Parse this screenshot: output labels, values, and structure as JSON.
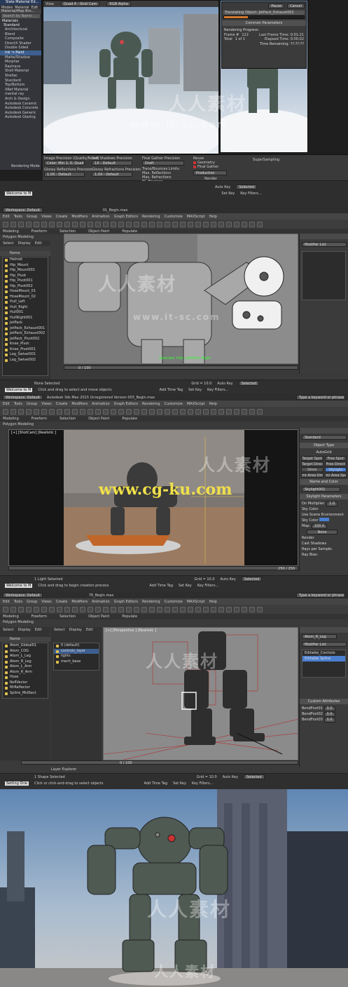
{
  "screen1": {
    "mat_browser_title": "Slate Material Ed...",
    "mat_browser_menu": [
      "Modes",
      "Material",
      "Edit"
    ],
    "mat_browser_search": "Search by Name ...",
    "mat_sections": [
      "Material/Map Bro...",
      "Materials",
      "Standard"
    ],
    "materials": [
      "Architectural",
      "Blend",
      "Composite",
      "DirectX Shader",
      "Double Sided",
      "Ink 'n Paint",
      "Matte/Shadow",
      "Morpher",
      "Raytrace",
      "Shell Material",
      "Shellac",
      "Standard",
      "Top/Bottom",
      "XRef Material",
      "mental ray",
      "Arch & Design",
      "Autodesk Ceramic",
      "Autodesk Concrete",
      "Autodesk Generic",
      "Autodesk Glazing"
    ],
    "render_setup_label": "Rendering Mode",
    "frame_toolbar": {
      "area": "View",
      "viewport": "Quad 4 - Shot Cam",
      "channel": "RGB Alpha"
    },
    "rendering_dialog": {
      "pause": "Pause",
      "cancel": "Cancel",
      "translating": "Translating Object: JetPack_Exhaust002",
      "common_params": "Common Parameters",
      "rendering_progress": "Rendering Progress:",
      "frame_label": "Frame #",
      "frame_value": "122",
      "total_label": "Total",
      "total_value": "1 of 1",
      "last_frame_time": "Last Frame Time:  0:01:21",
      "elapsed_time": "Elapsed Time:  0:00:02",
      "time_remaining": "Time Remaining:  ??:??:??"
    },
    "precision": {
      "image": "Image Precision (Quality/Noise)",
      "image_value": "Color: Min 1, 0, Quality 0.25",
      "soft_shadows": "Soft Shadows Precision",
      "soft_value": "1X - Default",
      "final_gather": "Final Gather Precision",
      "fg_value": "Draft",
      "glossy_refl": "Glossy Reflections Precision",
      "glossy_refl_value": "1.0X - Default",
      "glossy_refr": "Glossy Refractions Precision",
      "glossy_refr_value": "1.0X - Default",
      "trace_depth": "Trace/Bounces Limits",
      "max_refl": "Max. Reflections",
      "max_refr": "Max. Refractions",
      "fg_bounces": "FG Bounces",
      "reuse": "Reuse",
      "geometry": "Geometry",
      "final_gather_chk": "Final Gather",
      "production": "Production",
      "render_btn": "Render",
      "supersampling": "SuperSampling"
    },
    "status": {
      "welcome": "Welcome to M",
      "selected": "Selected",
      "auto_key": "Auto Key",
      "set_key": "Set Key",
      "key_filters": "Key Filters..."
    }
  },
  "screen2": {
    "file_title": "01_Begin.max",
    "workspace": "Workspace: Default",
    "menus": [
      "Edit",
      "Tools",
      "Group",
      "Views",
      "Create",
      "Modifiers",
      "Animation",
      "Graph Editors",
      "Rendering",
      "Customize",
      "MAXScript",
      "Help"
    ],
    "ribbon_tabs": [
      "Modeling",
      "Freeform",
      "Selection",
      "Object Paint",
      "Populate"
    ],
    "ribbon_label": "Polygon Modeling",
    "scene_tabs": [
      "Select",
      "Display",
      "Edit"
    ],
    "name_header": "Name",
    "objects": [
      "Helmet",
      "Hip_Mount",
      "Hip_Mount001",
      "Hip_Pivot",
      "Hip_Pivot001",
      "Hip_Pivot002",
      "HoseMount_01",
      "HoseMount_02",
      "Hull_Left",
      "Hull_Right",
      "Hull001",
      "HullRight001",
      "JetPack",
      "JetPack_Exhaust001",
      "JetPack_Exhaust002",
      "JetPack_Pivot002",
      "Knee_Pivot",
      "Knee_Pivot001",
      "Leg_Swivel001",
      "Leg_Swivel002"
    ],
    "modifier_list": "Modifier List",
    "selection_info": "Selected: Hull_Left/Hull_Right",
    "frame": "0 / 100",
    "grid": "Grid = 10.0",
    "add_time_tag": "Add Time Tag",
    "status": {
      "welcome": "Welcome to M",
      "selected_msg": "None Selected",
      "prompt": "Click and drag to select and move objects",
      "auto_key": "Auto Key",
      "selected": "Selected",
      "set_key": "Set Key",
      "key_filters": "Key Filters..."
    }
  },
  "screen3": {
    "file_title": "Autodesk 3ds Max 2015    Unregistered Version    003_Begin.max",
    "workspace": "Workspace: Default",
    "search": "Type a keyword or phrase",
    "menus": [
      "Edit",
      "Tools",
      "Group",
      "Views",
      "Create",
      "Modifiers",
      "Animation",
      "Graph Editors",
      "Rendering",
      "Customize",
      "MAXScript",
      "Help"
    ],
    "ribbon_tabs": [
      "Modeling",
      "Freeform",
      "Selection",
      "Object Paint",
      "Populate"
    ],
    "ribbon_label": "Polygon Modeling",
    "viewport_label": "[+] [ShotCam] [Realistic ]",
    "watermark_url": "www.cg-ku.com",
    "frame": "250 / 250",
    "cmd": {
      "standard": "Standard",
      "object_type": "Object Type",
      "autogrid": "AutoGrid",
      "lights": [
        [
          "Target Spot",
          "Free Spot"
        ],
        [
          "Target Direct",
          "Free Direct"
        ],
        [
          "Omni",
          "Skylight"
        ],
        [
          "mr Area Omni",
          "mr Area Spot"
        ]
      ],
      "name_color": "Name and Color",
      "light_name": "Skylight001",
      "skylight_params": "Skylight Parameters",
      "on": "On",
      "multiplier": "Multiplier:",
      "multiplier_val": "1.0",
      "sky_color": "Sky Color",
      "use_scene_env": "Use Scene Environment",
      "sky_color_opt": "Sky Color",
      "map": "Map:",
      "map_val": "100.0",
      "none": "None",
      "render": "Render",
      "cast_shadows": "Cast Shadows",
      "rays_per_sample": "Rays per Sample:",
      "ray_bias": "Ray Bias:"
    },
    "status": {
      "welcome": "Welcome to M",
      "selected_msg": "1 Light Selected",
      "prompt": "Click and drag to begin creation process",
      "auto_key": "Auto Key",
      "selected": "Selected",
      "set_key": "Set Key",
      "key_filters": "Key Filters...",
      "grid": "Grid = 10.0",
      "add_time_tag": "Add Time Tag"
    }
  },
  "screen4": {
    "file_title": "76_Begin.max",
    "workspace": "Workspace: Default",
    "search": "Type a keyword or phrase",
    "menus": [
      "Edit",
      "Tools",
      "Group",
      "Views",
      "Create",
      "Modifiers",
      "Animation",
      "Graph Editors",
      "Rendering",
      "Customize",
      "MAXScript",
      "Help"
    ],
    "ribbon_tabs": [
      "Modeling",
      "Freeform",
      "Selection",
      "Object Paint",
      "Populate"
    ],
    "ribbon_label": "Polygon Modeling",
    "scene_tabs": [
      "Select",
      "Display",
      "Edit"
    ],
    "layers_header": "Name",
    "layers": [
      "Atom_Global01",
      "Atom_COG",
      "Atom_L_Leg",
      "Atom_R_Leg",
      "Atom_L_Arm",
      "Atom_R_Arm",
      "Hose",
      "ReflVector",
      "MrReflector",
      "Spline_MidSect"
    ],
    "layer_objects": [
      "0 (default)",
      "controls_layer",
      "lights",
      "mech_base"
    ],
    "viewport_label": "[+] [Perspective ] [Realistic ]",
    "object_name": "Atom_R_Leg",
    "modifier_list": "Modifier List",
    "modifiers": [
      "Editable_Controls",
      "Editable Spline"
    ],
    "custom_attrs": "Custom Attributes",
    "bend_labels": [
      "BendFoot01",
      "BendFoot02",
      "BendFoot03"
    ],
    "bend_vals": [
      "0.0",
      "0.0",
      "0.0"
    ],
    "layer_explorer": "Layer Explorer",
    "frame": "0 / 100",
    "status": {
      "welcome": "Setting Orie",
      "selected_msg": "1 Shape Selected",
      "prompt": "Click or click-and-drag to select objects",
      "auto_key": "Auto Key",
      "selected": "Selected",
      "set_key": "Set Key",
      "key_filters": "Key Filters...",
      "grid": "Grid = 10.0",
      "add_time_tag": "Add Time Tag"
    }
  },
  "watermark_cn": "人人素材",
  "watermark_it": "www.it-sc.com",
  "colors": {
    "ui_bg": "#3a3a3a",
    "viewport_bg": "#6e6e6e",
    "selection_yellow": "#e0c050",
    "skylight_blue": "#4a7fd0",
    "watermark_yellow": "#f0e04a",
    "orange_platform": "#c0662a"
  }
}
